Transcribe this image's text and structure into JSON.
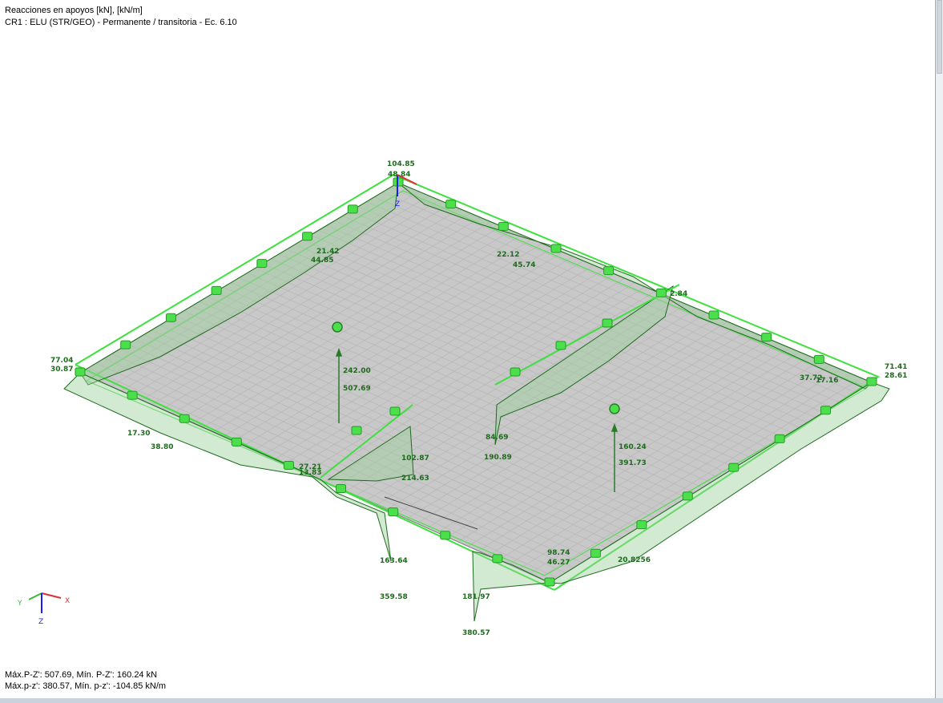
{
  "header": {
    "line1": "Reacciones en apoyos [kN], [kN/m]",
    "line2": "CR1 : ELU (STR/GEO) - Permanente / transitoria - Ec. 6.10"
  },
  "footer": {
    "line1": "Máx.P-Z': 507.69, Mín. P-Z': 160.24 kN",
    "line2": "Máx.p-z': 380.57, Mín. p-z': -104.85 kN/m"
  },
  "axes": {
    "x": "X",
    "y": "Y",
    "z": "Z",
    "origin_z": "Z"
  },
  "colors": {
    "slab": "#c8c8c8",
    "grid": "#b3b3b3",
    "support": "#3ee03e",
    "diagram": "#1e6b1e",
    "label": "#1e6b1e"
  },
  "labels": {
    "top_max": "104.85",
    "top_min": "48.84",
    "left_edge_a": "21.42",
    "left_edge_b": "44.85",
    "right_edge_a": "22.12",
    "right_edge_b": "45.74",
    "right_corner": "2.84",
    "left_corner_a": "77.04",
    "left_corner_b": "30.87",
    "right_corner_a": "71.41",
    "right_corner_b": "28.61",
    "right_mid_a": "37.72",
    "right_mid_b": "17.16",
    "left_front_a": "17.30",
    "left_front_b": "38.80",
    "col1_a": "242.00",
    "col1_b": "507.69",
    "col2_a": "160.24",
    "col2_b": "391.73",
    "wall1_a": "102.87",
    "wall1_b": "214.63",
    "wall1_c": "27.21",
    "wall1_d": "13.83",
    "wall2_a": "84.69",
    "wall2_b": "190.89",
    "front_a": "163.64",
    "front_b": "359.58",
    "front2_a": "181.97",
    "front2_b": "380.57",
    "bottom_a": "98.74",
    "bottom_b": "46.27",
    "bottom_right": "20.8256"
  }
}
